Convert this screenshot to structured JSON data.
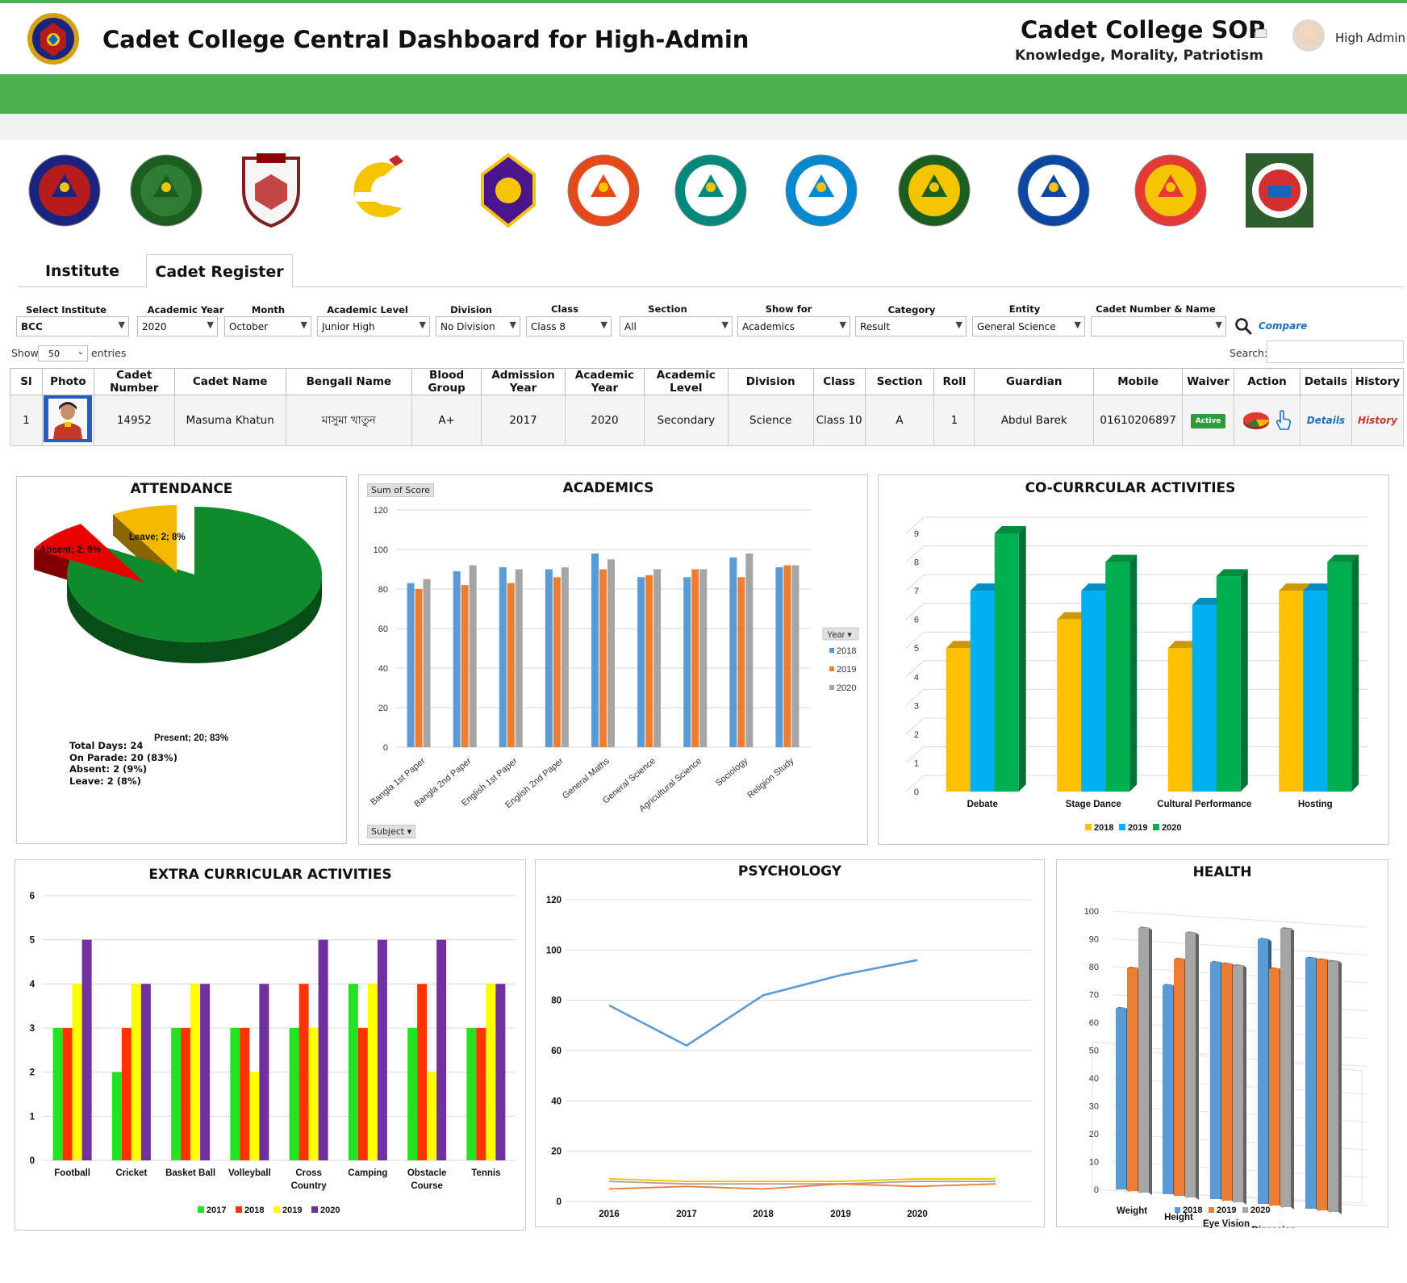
{
  "header": {
    "title": "Cadet College Central Dashboard for High-Admin",
    "sop_title": "Cadet College SOP",
    "motto": "Knowledge, Morality, Patriotism",
    "user_name": "High Admin"
  },
  "colleges": [
    {
      "name": "FAUJDARHAT CADET COLLEGE",
      "motto": "DEEDS NOT WORDS",
      "year": "1958"
    },
    {
      "name": "college-2"
    },
    {
      "name": "college-3",
      "motto": "জ্ঞানই বল"
    },
    {
      "name": "রাজশাহী ক্যাডেট কলেজ"
    },
    {
      "name": "college-5"
    },
    {
      "name": "college-6"
    },
    {
      "name": "college-7"
    },
    {
      "name": "college-8"
    },
    {
      "name": "college-9"
    },
    {
      "name": "college-10"
    },
    {
      "name": "college-11"
    },
    {
      "name": "college-12"
    }
  ],
  "tabs": {
    "institute": "Institute",
    "register": "Cadet Register"
  },
  "filters": {
    "select_institute": {
      "label": "Select Institute",
      "value": "BCC"
    },
    "academic_year": {
      "label": "Academic Year",
      "value": "2020"
    },
    "month": {
      "label": "Month",
      "value": "October"
    },
    "academic_level": {
      "label": "Academic Level",
      "value": "Junior High"
    },
    "division": {
      "label": "Division",
      "value": "No Division"
    },
    "class": {
      "label": "Class",
      "value": "Class 8"
    },
    "section": {
      "label": "Section",
      "value": "All"
    },
    "show_for": {
      "label": "Show for",
      "value": "Academics"
    },
    "category": {
      "label": "Category",
      "value": "Result"
    },
    "entity": {
      "label": "Entity",
      "value": "General Science"
    },
    "cadet": {
      "label": "Cadet Number & Name",
      "value": ""
    },
    "compare": "Compare"
  },
  "table_controls": {
    "show": "Show",
    "entries_value": "50",
    "entries": "entries",
    "search": "Search:"
  },
  "table": {
    "headers": [
      "Sl",
      "Photo",
      "Cadet Number",
      "Cadet Name",
      "Bengali Name",
      "Blood Group",
      "Admission Year",
      "Academic Year",
      "Academic Level",
      "Division",
      "Class",
      "Section",
      "Roll",
      "Guardian",
      "Mobile",
      "Waiver",
      "Action",
      "Details",
      "History"
    ],
    "row": {
      "sl": "1",
      "cadet_number": "14952",
      "cadet_name": "Masuma Khatun",
      "bengali_name": "মাসুমা খাতুন",
      "blood_group": "A+",
      "admission_year": "2017",
      "academic_year": "2020",
      "academic_level": "Secondary",
      "division": "Science",
      "class": "Class 10",
      "section": "A",
      "roll": "1",
      "guardian": "Abdul Barek",
      "mobile": "01610206897",
      "waiver": "Active",
      "details": "Details",
      "history": "History"
    }
  },
  "attendance": {
    "title": "ATTENDANCE",
    "chart_data": {
      "type": "pie",
      "slices": [
        {
          "label": "Present",
          "value": 20,
          "percent": 83,
          "color": "#0f8a2c"
        },
        {
          "label": "Absent",
          "value": 2,
          "percent": 9,
          "color": "#e80000"
        },
        {
          "label": "Leave",
          "value": 2,
          "percent": 8,
          "color": "#f5b800"
        }
      ]
    },
    "slice_labels": {
      "present": "Present; 20; 83%",
      "absent": "Absent; 2; 9%",
      "leave": "Leave; 2; 8%"
    },
    "summary": {
      "total": "Total Days: 24",
      "parade": "On Parade: 20 (83%)",
      "absent": "Absent: 2 (9%)",
      "leave": "Leave: 2 (8%)"
    }
  },
  "academics": {
    "title": "ACADEMICS",
    "field_button": "Sum of Score",
    "axis_button": "Subject",
    "legend_title": "Year",
    "chart_data": {
      "type": "bar",
      "categories": [
        "Bangla 1st Paper",
        "Bangla 2nd Paper",
        "English 1st Paper",
        "English 2nd Paper",
        "General Maths",
        "General Science",
        "Agricultural Science",
        "Sociology",
        "Religion Study"
      ],
      "series": [
        {
          "name": "2018",
          "color": "#5b9bd5",
          "values": [
            83,
            89,
            91,
            90,
            98,
            86,
            86,
            96,
            91
          ]
        },
        {
          "name": "2019",
          "color": "#ed7d31",
          "values": [
            80,
            82,
            83,
            86,
            90,
            87,
            90,
            86,
            92
          ]
        },
        {
          "name": "2020",
          "color": "#a5a5a5",
          "values": [
            85,
            92,
            90,
            91,
            95,
            90,
            90,
            98,
            92
          ]
        }
      ],
      "ylim": [
        0,
        120
      ],
      "yticks": [
        0,
        20,
        40,
        60,
        80,
        100,
        120
      ]
    }
  },
  "cocurricular": {
    "title": "CO-CURRCULAR ACTIVITIES",
    "chart_data": {
      "type": "bar",
      "categories": [
        "Debate",
        "Stage Dance",
        "Cultural Performance",
        "Hosting"
      ],
      "series": [
        {
          "name": "2018",
          "color": "#ffc000",
          "values": [
            5,
            6,
            5,
            7
          ]
        },
        {
          "name": "2019",
          "color": "#00b0f0",
          "values": [
            7,
            7,
            6.5,
            7
          ]
        },
        {
          "name": "2020",
          "color": "#00b050",
          "values": [
            9,
            8,
            7.5,
            8
          ]
        }
      ],
      "ylim": [
        0,
        9
      ],
      "yticks": [
        0,
        1,
        2,
        3,
        4,
        5,
        6,
        7,
        8,
        9
      ]
    }
  },
  "extracurricular": {
    "title": "EXTRA CURRICULAR ACTIVITIES",
    "chart_data": {
      "type": "bar",
      "categories": [
        "Football",
        "Cricket",
        "Basket Ball",
        "Volleyball",
        "Cross Country",
        "Camping",
        "Obstacle Course",
        "Tennis"
      ],
      "series": [
        {
          "name": "2017",
          "color": "#22e322",
          "values": [
            3,
            2,
            3,
            3,
            3,
            4,
            3,
            3
          ]
        },
        {
          "name": "2018",
          "color": "#ff3300",
          "values": [
            3,
            3,
            3,
            3,
            4,
            3,
            4,
            3
          ]
        },
        {
          "name": "2019",
          "color": "#ffff00",
          "values": [
            4,
            4,
            4,
            2,
            3,
            4,
            2,
            4
          ]
        },
        {
          "name": "2020",
          "color": "#7030a0",
          "values": [
            5,
            4,
            4,
            4,
            5,
            5,
            5,
            4
          ]
        }
      ],
      "ylim": [
        0,
        6
      ],
      "yticks": [
        0,
        1,
        2,
        3,
        4,
        5,
        6
      ]
    }
  },
  "psychology": {
    "title": "PSYCHOLOGY",
    "chart_data": {
      "type": "line",
      "x": [
        "2016",
        "2017",
        "2018",
        "2019",
        "2020"
      ],
      "series": [
        {
          "color": "#5b9bd5",
          "values": [
            78,
            62,
            82,
            90,
            96
          ]
        },
        {
          "color": "#ffc000",
          "values": [
            9,
            8,
            8,
            8,
            9,
            9
          ]
        },
        {
          "color": "#a5a5a5",
          "values": [
            8,
            7,
            7,
            7,
            8,
            8
          ]
        },
        {
          "color": "#ed7d31",
          "values": [
            5,
            6,
            5,
            7,
            6,
            7
          ]
        }
      ],
      "ylim": [
        0,
        120
      ],
      "yticks": [
        0,
        20,
        40,
        60,
        80,
        100,
        120
      ]
    }
  },
  "health": {
    "title": "HEALTH",
    "chart_data": {
      "type": "bar",
      "categories": [
        "Weight",
        "Height",
        "Eye Vision",
        "Digession",
        "Sleep"
      ],
      "series": [
        {
          "name": "2018",
          "color": "#5b9bd5",
          "values": [
            65,
            75,
            85,
            95,
            90
          ]
        },
        {
          "name": "2019",
          "color": "#ed7d31",
          "values": [
            80,
            85,
            85,
            85,
            90
          ]
        },
        {
          "name": "2020",
          "color": "#a5a5a5",
          "values": [
            95,
            95,
            85,
            100,
            90
          ]
        }
      ],
      "ylim": [
        0,
        100
      ],
      "yticks": [
        0,
        10,
        20,
        30,
        40,
        50,
        60,
        70,
        80,
        90,
        100
      ]
    }
  }
}
